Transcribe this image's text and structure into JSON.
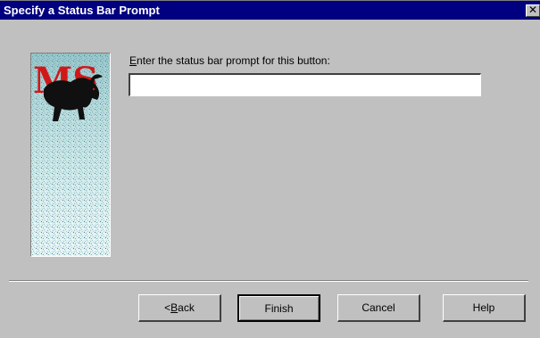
{
  "dialog": {
    "title": "Specify a Status Bar Prompt",
    "close_glyph": "✕"
  },
  "illustration": {
    "letters": "MS",
    "icon": "bull-icon"
  },
  "prompt": {
    "label_mnemonic": "E",
    "label_rest": "nter the status bar prompt for this button:",
    "value": ""
  },
  "buttons": {
    "back_prefix": "< ",
    "back_mnemonic": "B",
    "back_rest": "ack",
    "finish": "Finish",
    "cancel": "Cancel",
    "help": "Help"
  },
  "colors": {
    "titlebar": "#000080",
    "dialog_bg": "#c0c0c0",
    "logo_red": "#d01818"
  }
}
